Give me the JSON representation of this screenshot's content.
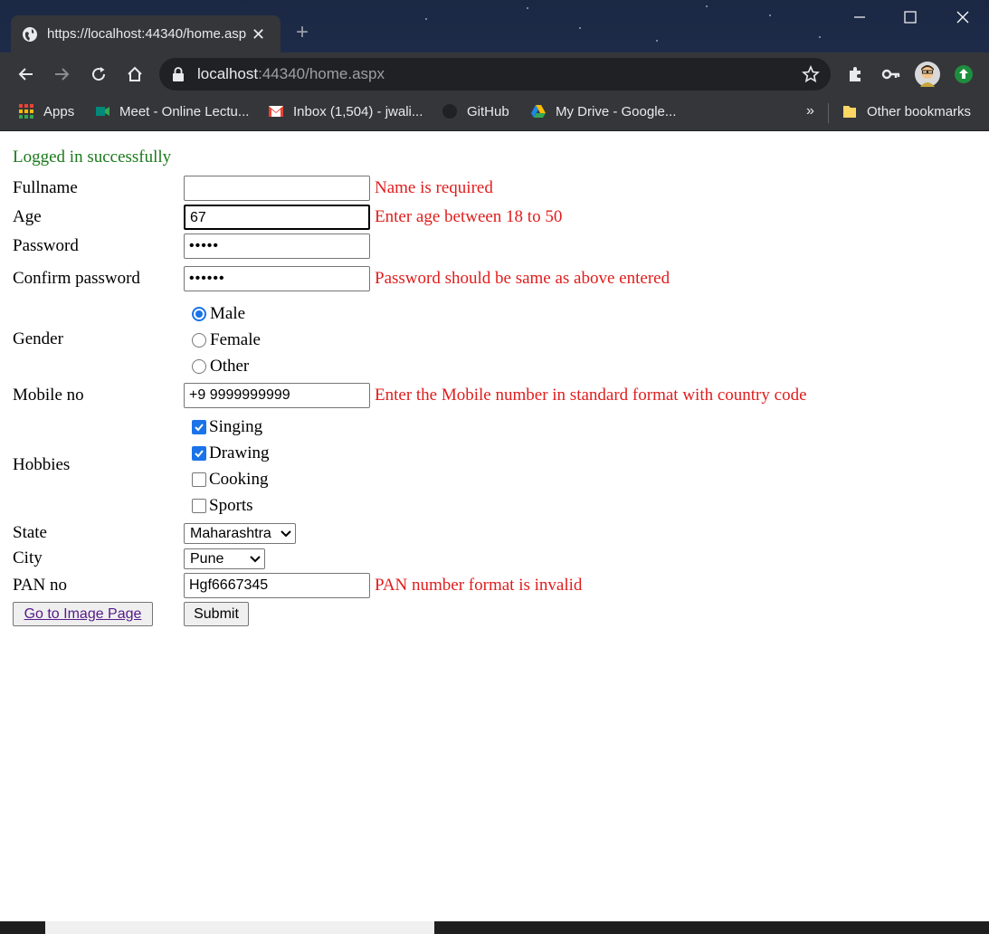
{
  "browser": {
    "tab_title": "https://localhost:44340/home.aspx",
    "url_host": "localhost",
    "url_rest": ":44340/home.aspx",
    "bookmarks": [
      {
        "label": "Apps",
        "icon": "apps-grid-icon"
      },
      {
        "label": "Meet - Online Lectu...",
        "icon": "meet-icon"
      },
      {
        "label": "Inbox (1,504) - jwali...",
        "icon": "gmail-icon"
      },
      {
        "label": "GitHub",
        "icon": "github-icon"
      },
      {
        "label": "My Drive - Google...",
        "icon": "drive-icon"
      }
    ],
    "more_bookmarks": "»",
    "other_bookmarks": "Other bookmarks"
  },
  "page": {
    "status": "Logged in successfully",
    "status_color": "#1a7a1a",
    "error_color": "#e11d1d",
    "fullname": {
      "label": "Fullname",
      "value": "",
      "error": "Name is required"
    },
    "age": {
      "label": "Age",
      "value": "67",
      "error": "Enter age between 18 to 50"
    },
    "password": {
      "label": "Password",
      "value": "•••••"
    },
    "confirm_password": {
      "label": "Confirm password",
      "value": "••••••",
      "error": "Password should be same as above entered"
    },
    "gender": {
      "label": "Gender",
      "options": [
        "Male",
        "Female",
        "Other"
      ],
      "selected": "Male"
    },
    "mobile": {
      "label": "Mobile no",
      "value": "+9 9999999999",
      "error": "Enter the Mobile number in standard format with country code"
    },
    "hobbies": {
      "label": "Hobbies",
      "options": [
        "Singing",
        "Drawing",
        "Cooking",
        "Sports"
      ],
      "checked": [
        "Singing",
        "Drawing"
      ]
    },
    "state": {
      "label": "State",
      "value": "Maharashtra"
    },
    "city": {
      "label": "City",
      "value": "Pune"
    },
    "pan": {
      "label": "PAN no",
      "value": "Hgf6667345",
      "error": "PAN number format is invalid"
    },
    "image_link": "Go to Image Page",
    "submit": "Submit"
  }
}
